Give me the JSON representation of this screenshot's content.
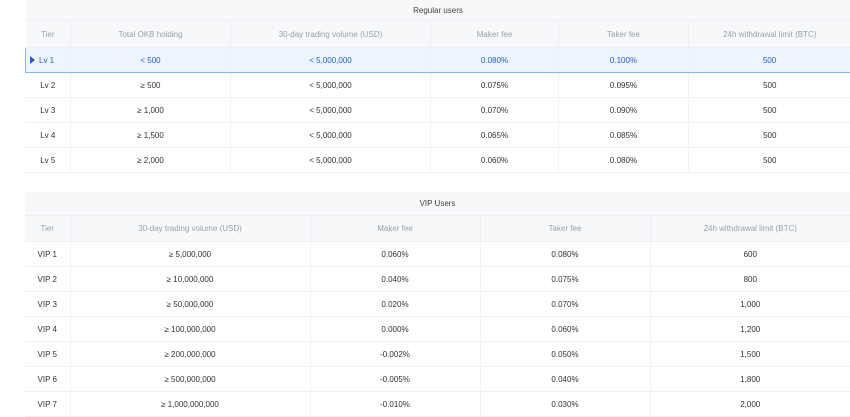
{
  "regular": {
    "caption": "Regular users",
    "headers": [
      "Tier",
      "Total OKB holding",
      "30-day trading volume (USD)",
      "Maker fee",
      "Taker fee",
      "24h withdrawal limit (BTC)"
    ],
    "rows": [
      [
        "Lv 1",
        "< 500",
        "< 5,000,000",
        "0.080%",
        "0.100%",
        "500"
      ],
      [
        "Lv 2",
        "≥ 500",
        "< 5,000,000",
        "0.075%",
        "0.095%",
        "500"
      ],
      [
        "Lv 3",
        "≥ 1,000",
        "< 5,000,000",
        "0.070%",
        "0.090%",
        "500"
      ],
      [
        "Lv 4",
        "≥ 1,500",
        "< 5,000,000",
        "0.065%",
        "0.085%",
        "500"
      ],
      [
        "Lv 5",
        "≥ 2,000",
        "< 5,000,000",
        "0.060%",
        "0.080%",
        "500"
      ]
    ]
  },
  "vip": {
    "caption": "VIP Users",
    "headers": [
      "Tier",
      "30-day trading volume (USD)",
      "Maker fee",
      "Taker fee",
      "24h withdrawal limit (BTC)"
    ],
    "rows": [
      [
        "VIP 1",
        "≥ 5,000,000",
        "0.060%",
        "0.080%",
        "600"
      ],
      [
        "VIP 2",
        "≥ 10,000,000",
        "0.040%",
        "0.075%",
        "800"
      ],
      [
        "VIP 3",
        "≥ 50,000,000",
        "0.020%",
        "0.070%",
        "1,000"
      ],
      [
        "VIP 4",
        "≥ 100,000,000",
        "0.000%",
        "0.060%",
        "1,200"
      ],
      [
        "VIP 5",
        "≥ 200,000,000",
        "-0.002%",
        "0.050%",
        "1,500"
      ],
      [
        "VIP 6",
        "≥ 500,000,000",
        "-0.005%",
        "0.040%",
        "1,800"
      ],
      [
        "VIP 7",
        "≥ 1,000,000,000",
        "-0.010%",
        "0.030%",
        "2,000"
      ]
    ]
  },
  "colors": {
    "accent": "#1f5fd4",
    "selected_bg": "#eef5ff",
    "header_bg": "#f7f8fa"
  },
  "icons": {
    "selected_row_marker": "caret-right-icon"
  }
}
